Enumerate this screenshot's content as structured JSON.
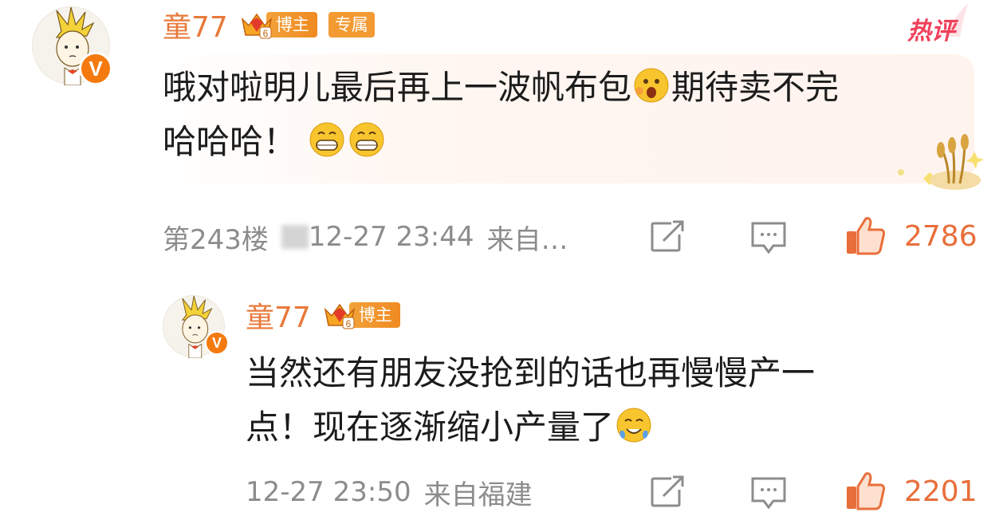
{
  "main_comment": {
    "username": "童77",
    "badge_blogger": "博主",
    "badge_exclusive": "专属",
    "hot_label": "热评",
    "content_line1": "哦对啦明儿最后再上一波帆布包",
    "content_line1b": "期待卖不完",
    "content_line2": "哈哈哈！",
    "floor": "第243楼",
    "time": "12-27 23:44",
    "source": "来自…",
    "like_count": "2786",
    "emojis": [
      "surprised-emoji",
      "grin-emoji",
      "grin-emoji"
    ]
  },
  "reply_comment": {
    "username": "童77",
    "badge_blogger": "博主",
    "content_line1": "当然还有朋友没抢到的话也再慢慢产一",
    "content_line2": "点！现在逐渐缩小产量了",
    "time": "12-27 23:50",
    "source": "来自福建",
    "like_count": "2201",
    "emojis": [
      "sweat-smile-emoji"
    ]
  },
  "colors": {
    "accent": "#e8793a",
    "like": "#e86e3a",
    "meta": "#8c8c8c",
    "hot": "#f0405a",
    "verified": "#f47a0f"
  }
}
